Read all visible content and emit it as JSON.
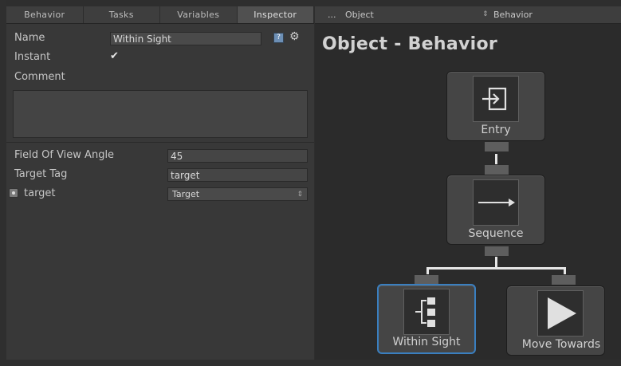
{
  "tabs": [
    "Behavior",
    "Tasks",
    "Variables",
    "Inspector"
  ],
  "active_tab": "Inspector",
  "graph_bar": {
    "ellipsis": "...",
    "object": "Object",
    "behavior": "Behavior",
    "dropdown_arrow": "⇕"
  },
  "graph_title": "Object - Behavior",
  "inspector": {
    "name_label": "Name",
    "name_value": "Within Sight",
    "instant_label": "Instant",
    "instant_checked": true,
    "comment_label": "Comment",
    "comment_value": "",
    "fov_label": "Field Of View Angle",
    "fov_value": "45",
    "target_tag_label": "Target Tag",
    "target_tag_value": "target",
    "target_var_label": "target",
    "target_var_value": "Target",
    "help_icon": "?",
    "gear_icon": "⚙"
  },
  "nodes": {
    "entry": "Entry",
    "sequence": "Sequence",
    "within_sight": "Within Sight",
    "move_towards": "Move Towards"
  }
}
